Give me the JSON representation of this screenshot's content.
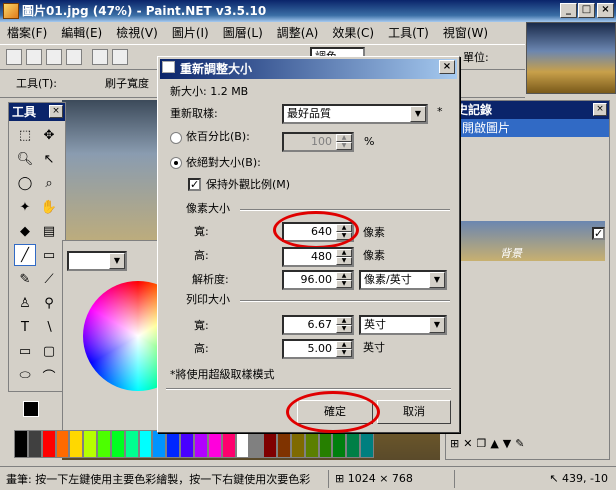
{
  "window": {
    "title": "圖片01.jpg (47%) - Paint.NET v3.5.10"
  },
  "menu": [
    "檔案(F)",
    "編輯(E)",
    "檢視(V)",
    "圖片(I)",
    "圖層(L)",
    "調整(A)",
    "效果(C)",
    "工具(T)",
    "視窗(W)"
  ],
  "toolbar": {
    "unit_label": "單位:",
    "layer_combo": "調色",
    "tool_label": "工具(T):",
    "brush_label": "刷子寬度"
  },
  "tools_panel": {
    "title": "工具"
  },
  "history_panel": {
    "title": "史記錄",
    "item": "開啟圖片",
    "layer_title": "背景"
  },
  "dialog": {
    "title": "重新調整大小",
    "new_size": "新大小: 1.2 MB",
    "resample_label": "重新取樣:",
    "resample_value": "最好品質",
    "asterisk": "*",
    "by_percent_label": "依百分比(B):",
    "percent_value": "100",
    "percent_unit": "%",
    "by_abs_label": "依絕對大小(B):",
    "keep_aspect_label": "保持外觀比例(M)",
    "pixel_size_heading": "像素大小",
    "width_label": "寬:",
    "width_value": "640",
    "width_unit": "像素",
    "height_label": "高:",
    "height_value": "480",
    "height_unit": "像素",
    "resolution_label": "解析度:",
    "resolution_value": "96.00",
    "resolution_unit": "像素/英寸",
    "print_size_heading": "列印大小",
    "print_width_label": "寬:",
    "print_width_value": "6.67",
    "print_width_unit": "英寸",
    "print_height_label": "高:",
    "print_height_value": "5.00",
    "print_height_unit": "英寸",
    "note": "*將使用超級取樣模式",
    "ok_label": "確定",
    "cancel_label": "取消"
  },
  "status": {
    "hint": "畫筆: 按一下左鍵使用主要色彩繪製，按一下右鍵使用次要色彩",
    "image_size": "1024 × 768",
    "cursor": "439, -10"
  },
  "colors": {
    "accent": "#0a246a",
    "highlight_oval": "#e00000"
  }
}
